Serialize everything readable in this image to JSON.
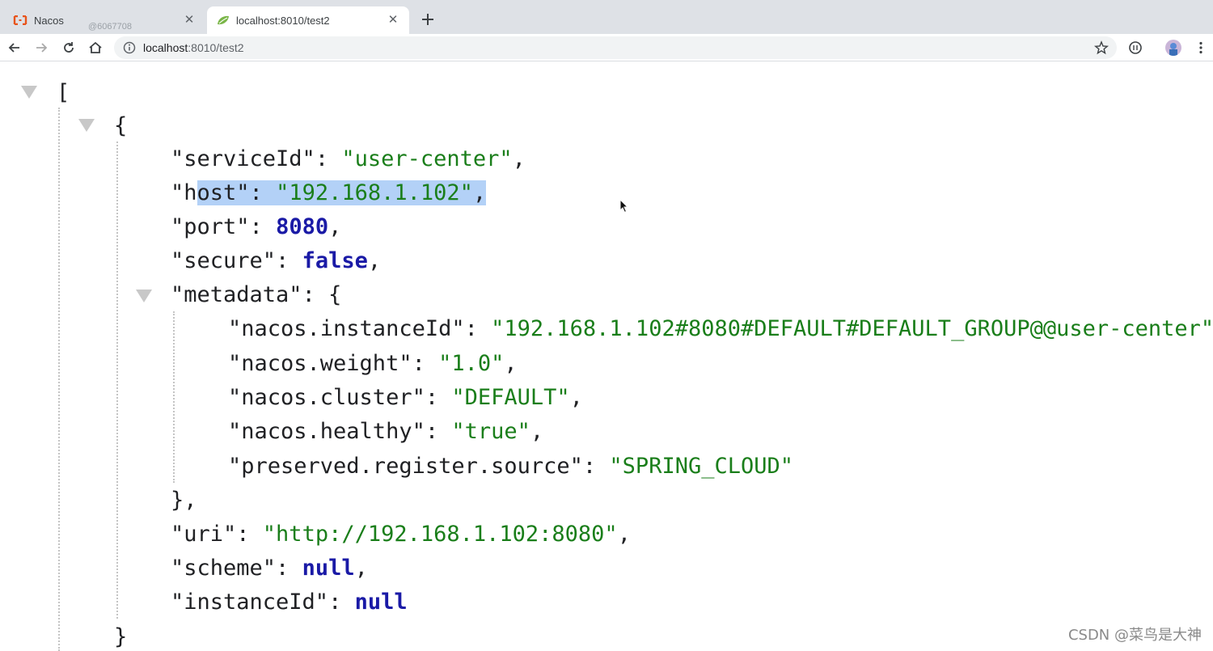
{
  "tabs": [
    {
      "title": "Nacos",
      "icon": "nacos-icon",
      "active": false
    },
    {
      "title": "localhost:8010/test2",
      "icon": "spring-leaf-icon",
      "active": true
    }
  ],
  "tab_watermark": "@6067708",
  "toolbar": {
    "url_host": "localhost",
    "url_rest": ":8010/test2"
  },
  "json": {
    "open_array": "[",
    "open_object": "{",
    "service_id_key": "\"serviceId\"",
    "service_id_value": "\"user-center\"",
    "host_key_start": "\"h",
    "host_key_end": "ost\"",
    "host_value": "\"192.168.1.102\"",
    "port_key": "\"port\"",
    "port_value": "8080",
    "secure_key": "\"secure\"",
    "secure_value": "false",
    "metadata_key": "\"metadata\"",
    "instance_key": "\"nacos.instanceId\"",
    "instance_value": "\"192.168.1.102#8080#DEFAULT#DEFAULT_GROUP@@user-center\"",
    "weight_key": "\"nacos.weight\"",
    "weight_value": "\"1.0\"",
    "cluster_key": "\"nacos.cluster\"",
    "cluster_value": "\"DEFAULT\"",
    "healthy_key": "\"nacos.healthy\"",
    "healthy_value": "\"true\"",
    "source_key": "\"preserved.register.source\"",
    "source_value": "\"SPRING_CLOUD\"",
    "close_metadata": "},",
    "uri_key": "\"uri\"",
    "uri_value": "\"http://192.168.1.102:8080\"",
    "scheme_key": "\"scheme\"",
    "scheme_value": "null",
    "instance_id_key": "\"instanceId\"",
    "instance_id_value": "null",
    "close_object": "}"
  },
  "watermark": "CSDN @菜鸟是大神",
  "colors": {
    "string": "#1a7e1a",
    "keyword": "#1a1aa6",
    "selection": "#b3d1f7"
  }
}
